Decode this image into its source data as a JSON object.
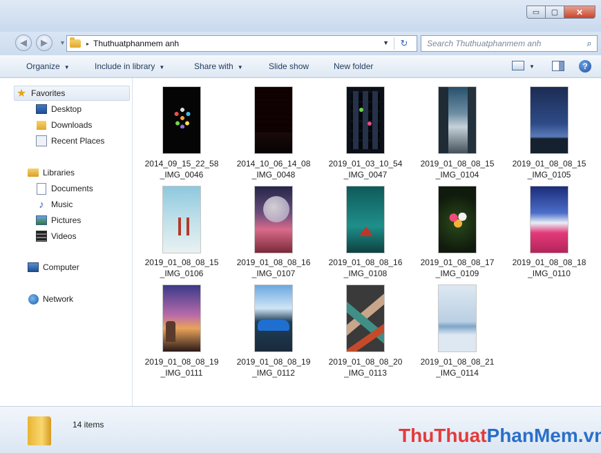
{
  "window": {
    "buttons": {
      "minimize": "▭",
      "maximize": "▢",
      "close": "✕"
    }
  },
  "address_bar": {
    "path": "Thuthuatphanmem anh",
    "arrow": "▸",
    "dropdown": "▼",
    "refresh": "↻"
  },
  "search": {
    "placeholder": "Search Thuthuatphanmem anh",
    "icon": "search-icon"
  },
  "toolbar": {
    "organize": "Organize",
    "include_in_library": "Include in library",
    "share_with": "Share with",
    "slide_show": "Slide show",
    "new_folder": "New folder",
    "help": "?"
  },
  "sidebar": {
    "favorites": {
      "label": "Favorites",
      "items": [
        "Desktop",
        "Downloads",
        "Recent Places"
      ]
    },
    "libraries": {
      "label": "Libraries",
      "items": [
        "Documents",
        "Music",
        "Pictures",
        "Videos"
      ]
    },
    "computer": "Computer",
    "network": "Network"
  },
  "files": [
    {
      "line1": "2014_09_15_22_58",
      "line2": "_IMG_0046"
    },
    {
      "line1": "2014_10_06_14_08",
      "line2": "_IMG_0048"
    },
    {
      "line1": "2019_01_03_10_54",
      "line2": "_IMG_0047"
    },
    {
      "line1": "2019_01_08_08_15",
      "line2": "_IMG_0104"
    },
    {
      "line1": "2019_01_08_08_15",
      "line2": "_IMG_0105"
    },
    {
      "line1": "2019_01_08_08_15",
      "line2": "_IMG_0106"
    },
    {
      "line1": "2019_01_08_08_16",
      "line2": "_IMG_0107"
    },
    {
      "line1": "2019_01_08_08_16",
      "line2": "_IMG_0108"
    },
    {
      "line1": "2019_01_08_08_17",
      "line2": "_IMG_0109"
    },
    {
      "line1": "2019_01_08_08_18",
      "line2": "_IMG_0110"
    },
    {
      "line1": "2019_01_08_08_19",
      "line2": "_IMG_0111"
    },
    {
      "line1": "2019_01_08_08_19",
      "line2": "_IMG_0112"
    },
    {
      "line1": "2019_01_08_08_20",
      "line2": "_IMG_0113"
    },
    {
      "line1": "2019_01_08_08_21",
      "line2": "_IMG_0114"
    }
  ],
  "status": {
    "items": "14 items"
  },
  "watermark": {
    "part1": "ThuThuat",
    "part2": "PhanMem",
    "part3": ".vn"
  },
  "colors": {
    "watermark_red": "#e23b3b",
    "watermark_blue": "#2a6fc9",
    "accent": "#1e395b"
  }
}
